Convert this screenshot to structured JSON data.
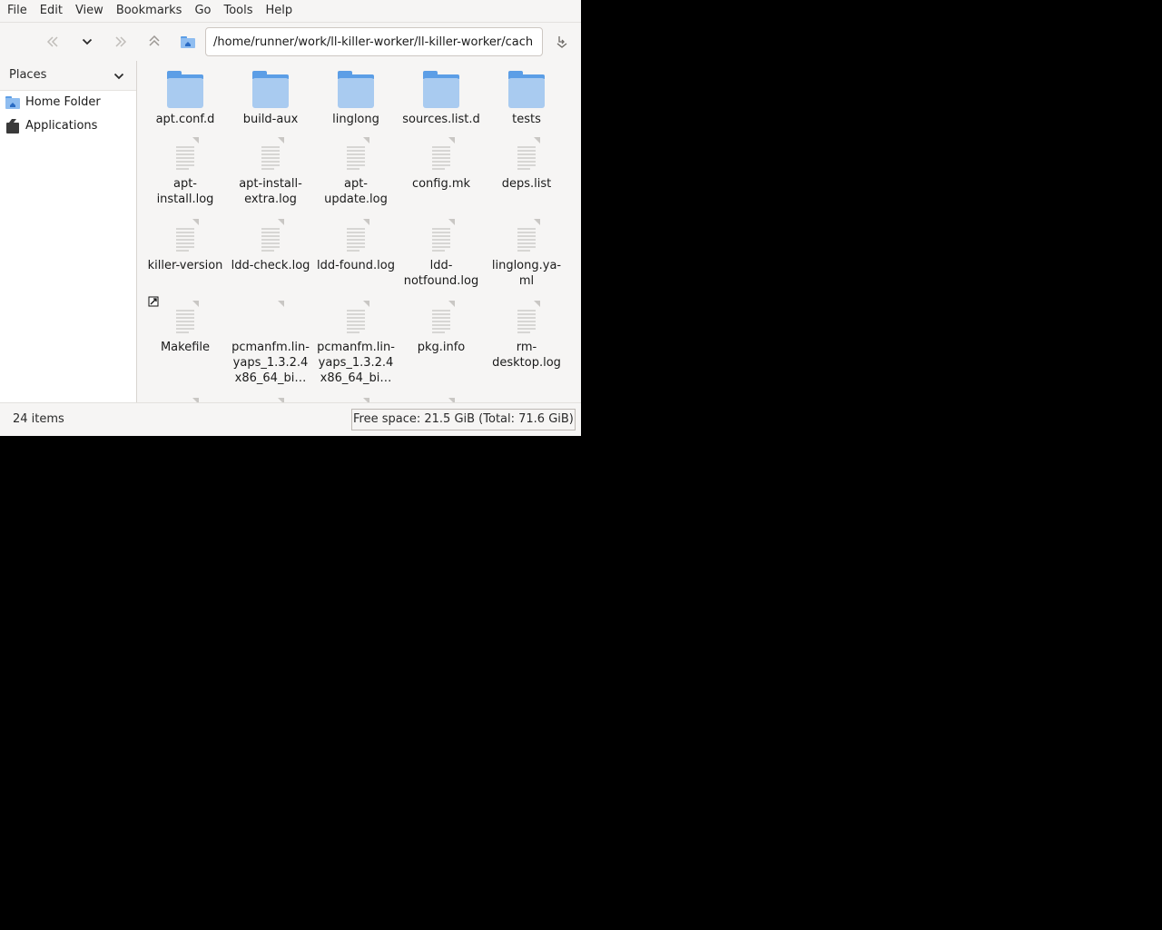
{
  "menubar": [
    "File",
    "Edit",
    "View",
    "Bookmarks",
    "Go",
    "Tools",
    "Help"
  ],
  "toolbar": {
    "path": "/home/runner/work/ll-killer-worker/ll-killer-worker/cach"
  },
  "sidebar": {
    "header": "Places",
    "items": [
      {
        "label": "Home Folder",
        "icon": "home-folder-icon"
      },
      {
        "label": "Applications",
        "icon": "applications-icon"
      }
    ]
  },
  "files": [
    {
      "name": "apt.conf.d",
      "type": "folder"
    },
    {
      "name": "build-aux",
      "type": "folder"
    },
    {
      "name": "linglong",
      "type": "folder"
    },
    {
      "name": "sources.list.d",
      "type": "folder"
    },
    {
      "name": "tests",
      "type": "folder"
    },
    {
      "name": "apt-\ninstall.log",
      "type": "file"
    },
    {
      "name": "apt-install-\nextra.log",
      "type": "file"
    },
    {
      "name": "apt-\nupdate.log",
      "type": "file"
    },
    {
      "name": "config.mk",
      "type": "file"
    },
    {
      "name": "deps.list",
      "type": "file"
    },
    {
      "name": "killer-version",
      "type": "file"
    },
    {
      "name": "ldd-check.log",
      "type": "file"
    },
    {
      "name": "ldd-found.log",
      "type": "file"
    },
    {
      "name": "ldd-\nnotfound.log",
      "type": "file"
    },
    {
      "name": "linglong.ya-\nml",
      "type": "file"
    },
    {
      "name": "Makefile",
      "type": "link"
    },
    {
      "name": "pcmanfm.lin-\nyaps_1.3.2.4\nx86_64_bi…",
      "type": "blank"
    },
    {
      "name": "pcmanfm.lin-\nyaps_1.3.2.4\nx86_64_bi…",
      "type": "file"
    },
    {
      "name": "pkg.info",
      "type": "file"
    },
    {
      "name": "rm-\ndesktop.log",
      "type": "file"
    }
  ],
  "status": {
    "count": "24 items",
    "free_space": "Free space: 21.5 GiB (Total: 71.6 GiB)"
  },
  "colors": {
    "folder": "#a9cbf0",
    "folder_tab": "#5c9ee6",
    "accent": "#3584e4"
  }
}
